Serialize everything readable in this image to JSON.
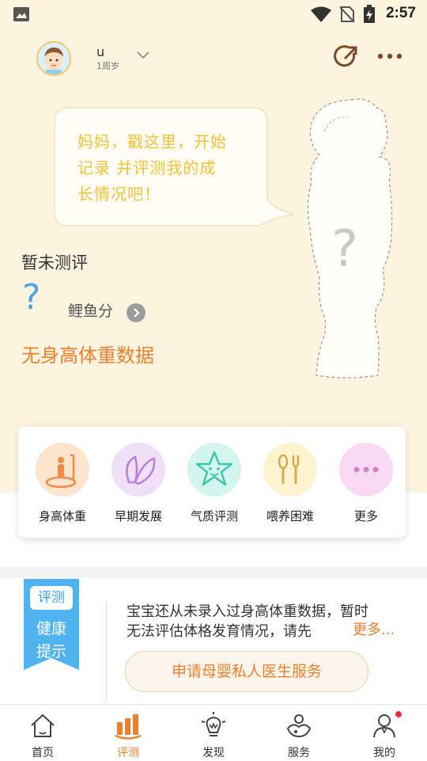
{
  "status_bar": {
    "time": "2:57"
  },
  "profile": {
    "name": "u",
    "age": "1周岁"
  },
  "bubble": {
    "line1": "妈妈，戳这里，开始",
    "line2": "记录 并评测我的成",
    "line3": "长情况吧！"
  },
  "silhouette": {
    "mark": "?"
  },
  "evaluation": {
    "title": "暂未测评",
    "score_mark": "?",
    "score_label": "鲤鱼分",
    "no_data": "无身高体重数据"
  },
  "functions": [
    {
      "label": "身高体重",
      "icon": "ruler-person-icon",
      "color": "#fde4cc"
    },
    {
      "label": "早期发展",
      "icon": "leaf-icon",
      "color": "#efdff7"
    },
    {
      "label": "气质评测",
      "icon": "star-face-icon",
      "color": "#d3f5ee"
    },
    {
      "label": "喂养困难",
      "icon": "spoon-fork-icon",
      "color": "#fdf4cf"
    },
    {
      "label": "更多",
      "icon": "more-dots-icon",
      "color": "#f8dbf3"
    }
  ],
  "health_tips": {
    "badge": "评测",
    "title_line1": "健康",
    "title_line2": "提示",
    "text_line1": "宝宝还从未录入过身高体重数据，暂时",
    "text_line2": "无法评估体格发育情况，请先",
    "more": "更多...",
    "button": "申请母婴私人医生服务"
  },
  "nav": [
    {
      "label": "首页",
      "icon": "home-icon"
    },
    {
      "label": "评测",
      "icon": "chart-bars-icon",
      "active": true
    },
    {
      "label": "发现",
      "icon": "bulb-icon"
    },
    {
      "label": "服务",
      "icon": "service-icon"
    },
    {
      "label": "我的",
      "icon": "profile-icon",
      "badge": true
    }
  ],
  "colors": {
    "accent": "#f07f2c",
    "hero_bg": "#fdf4e0",
    "bubble_text": "#f5c136",
    "ribbon": "#4eb3ef"
  }
}
